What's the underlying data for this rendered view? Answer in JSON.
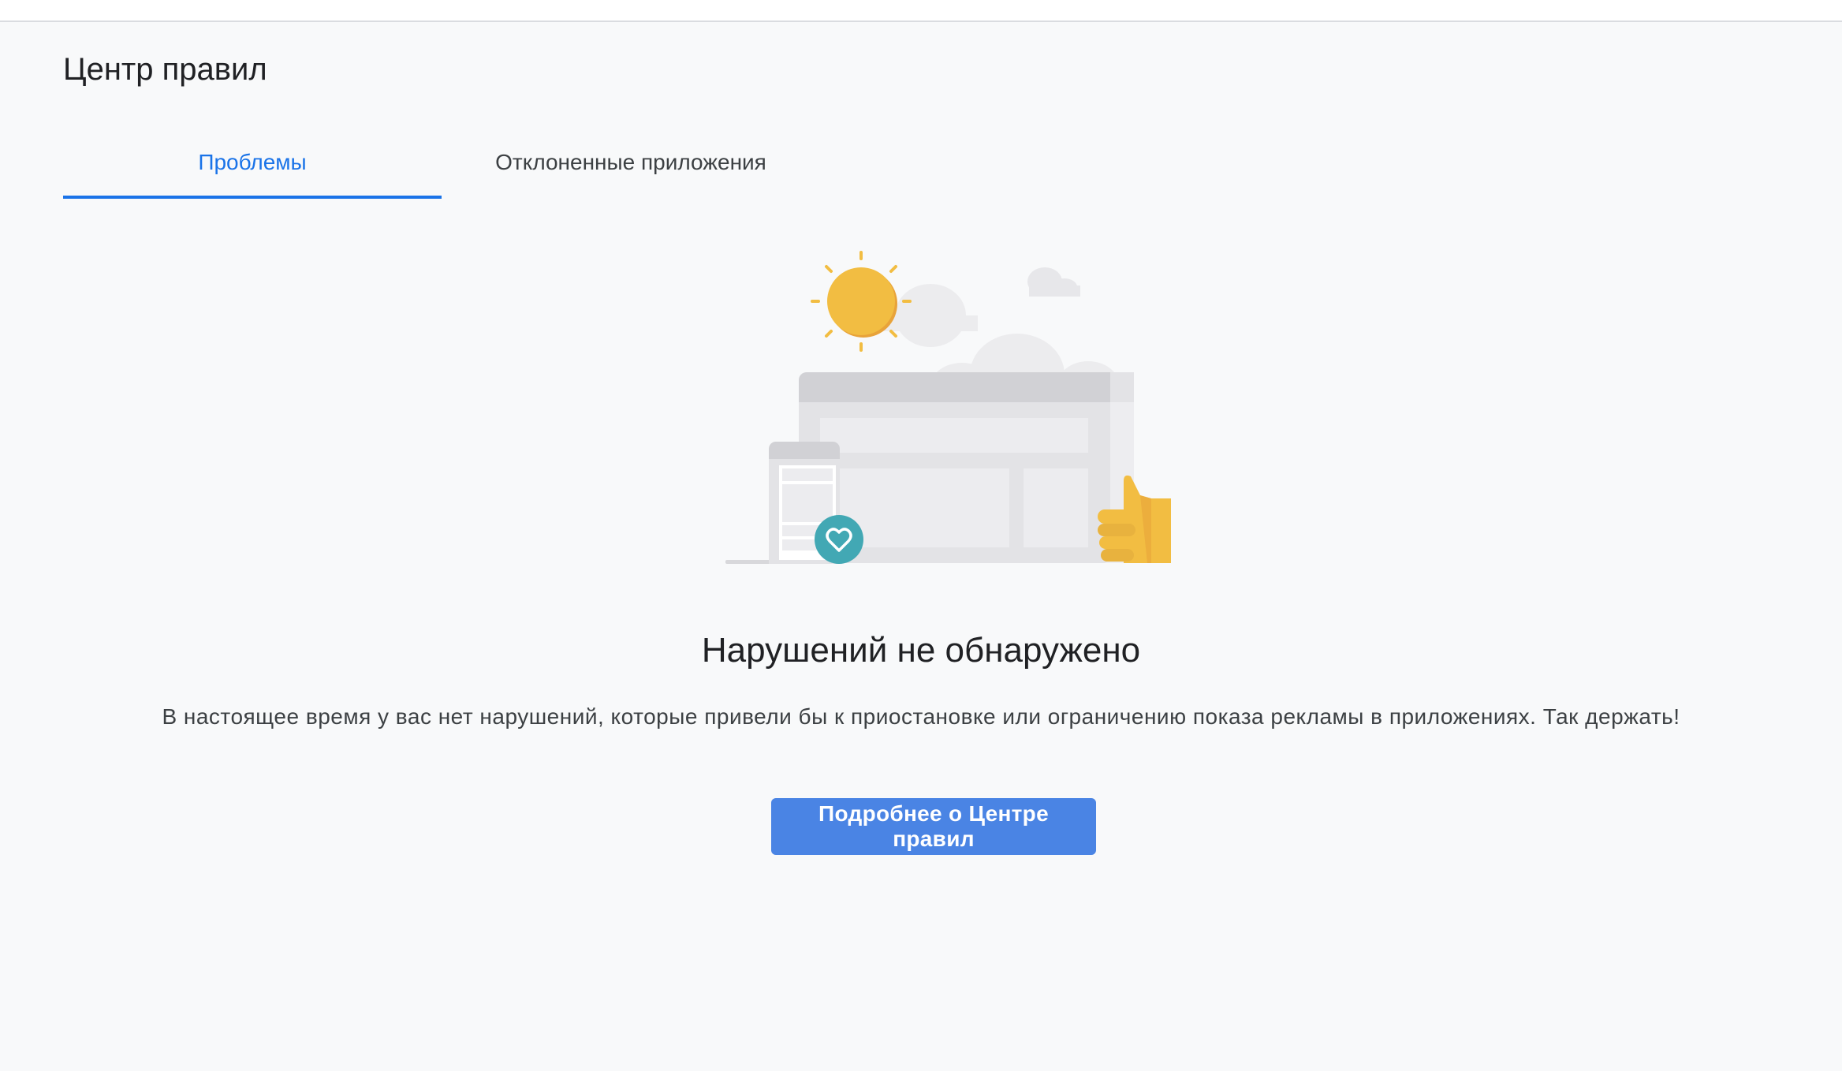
{
  "page": {
    "title": "Центр правил"
  },
  "tabs": [
    {
      "label": "Проблемы",
      "active": true
    },
    {
      "label": "Отклоненные приложения",
      "active": false
    }
  ],
  "empty_state": {
    "illustration_icon": "sun-browser-thumbs-up-illustration",
    "heading": "Нарушений не обнаружено",
    "body": "В настоящее время у вас нет нарушений, которые привели бы к приостановке или ограничению показа рекламы в приложениях. Так держать!",
    "button_label": "Подробнее о Центре правил"
  },
  "colors": {
    "background": "#f8f9fa",
    "accent": "#1a73e8",
    "button": "#4a84e4",
    "sun": "#f2bd42",
    "heart_badge": "#42a8b4"
  }
}
